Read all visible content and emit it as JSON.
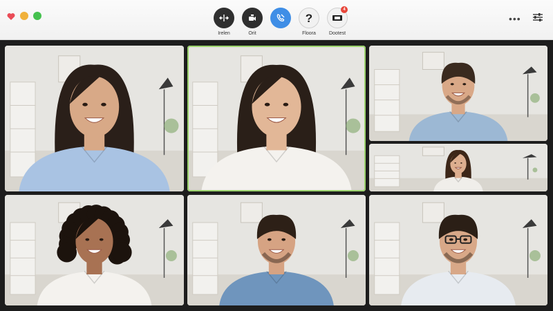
{
  "window": {
    "traffic_lights": [
      {
        "name": "close",
        "color": "#ea4c57",
        "icon": "heart-icon"
      },
      {
        "name": "minimize",
        "color": "#f0b13b"
      },
      {
        "name": "maximize",
        "color": "#45c14f"
      }
    ]
  },
  "toolbar": {
    "controls": [
      {
        "id": "irelen",
        "label": "Irelen",
        "icon": "split-view-icon",
        "bg": "#2f2f2f"
      },
      {
        "id": "orit",
        "label": "Orit",
        "icon": "video-camera-icon",
        "bg": "#2f2f2f"
      },
      {
        "id": "call",
        "label": "",
        "icon": "phone-icon",
        "bg": "#3f8ee6"
      },
      {
        "id": "floora",
        "label": "Floora",
        "icon": "question-icon",
        "bg": "#f1f1f1"
      },
      {
        "id": "dootest",
        "label": "Dootest",
        "icon": "screen-share-icon",
        "bg": "#f1f1f1",
        "badge": "4"
      }
    ],
    "more_icon": "more-dots-icon",
    "settings_icon": "sliders-icon"
  },
  "colors": {
    "active_speaker_border": "#9ad26a",
    "accent": "#3f8ee6"
  },
  "participants": [
    {
      "id": "p1",
      "active": false,
      "shirt": "#a9c3e3",
      "hair": "#2a1f19",
      "hair_style": "long",
      "skin": "#d8a987"
    },
    {
      "id": "p2",
      "active": true,
      "shirt": "#f4f2ee",
      "hair": "#2a1f18",
      "hair_style": "long",
      "skin": "#e2b797"
    },
    {
      "id": "p3",
      "active": false,
      "shirt": "#9cb8d4",
      "hair": "#3a2a1f",
      "hair_style": "short",
      "skin": "#d9a887"
    },
    {
      "id": "p4",
      "active": false,
      "shirt": "#f0eeea",
      "hair": "#3c2618",
      "hair_style": "long",
      "skin": "#ddae8f"
    },
    {
      "id": "p5",
      "active": false,
      "shirt": "#f4f2ee",
      "hair": "#1c130d",
      "hair_style": "curly",
      "skin": "#a87253"
    },
    {
      "id": "p6",
      "active": false,
      "shirt": "#6f95bd",
      "hair": "#2d2017",
      "hair_style": "short",
      "skin": "#d6a383"
    },
    {
      "id": "p7",
      "active": false,
      "shirt": "#e7ebf0",
      "hair": "#2b1f16",
      "hair_style": "short-glasses",
      "skin": "#d8a888"
    }
  ]
}
